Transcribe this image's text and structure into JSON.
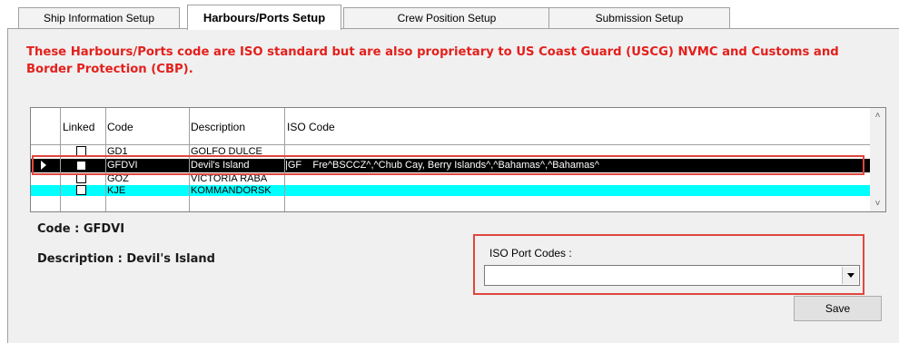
{
  "tabs": [
    {
      "label": "Ship Information Setup",
      "active": false
    },
    {
      "label": "Harbours/Ports Setup",
      "active": true
    },
    {
      "label": "Crew Position Setup",
      "active": false
    },
    {
      "label": "Submission Setup",
      "active": false
    }
  ],
  "notice": "These Harbours/Ports code are ISO standard but are also proprietary to US Coast Guard (USCG) NVMC and Customs and Border Protection (CBP).",
  "grid": {
    "columns": [
      "Linked",
      "Code",
      "Description",
      "ISO Code"
    ],
    "rows": [
      {
        "code": "GD1",
        "description": "GOLFO DULCE",
        "iso": "",
        "linked": false
      },
      {
        "code": "GFDVI",
        "description": "Devil's Island",
        "iso": "|GF    Fre^BSCCZ^,^Chub Cay, Berry Islands^,^Bahamas^,^Bahamas^",
        "linked": false
      },
      {
        "code": "GOZ",
        "description": "VICTORIA RABA",
        "iso": "",
        "linked": false
      },
      {
        "code": "KJE",
        "description": "KOMMANDORSK",
        "iso": "",
        "linked": false
      }
    ]
  },
  "details": {
    "code_text": "Code : GFDVI",
    "description_text": "Description : Devil's Island"
  },
  "iso_port_codes": {
    "label": "ISO Port Codes :",
    "value": ""
  },
  "save_label": "Save",
  "colors": {
    "notice": "#e3201c",
    "highlight_row": "#00ffff",
    "selected_row": "#000000",
    "outline": "#e0473e"
  }
}
